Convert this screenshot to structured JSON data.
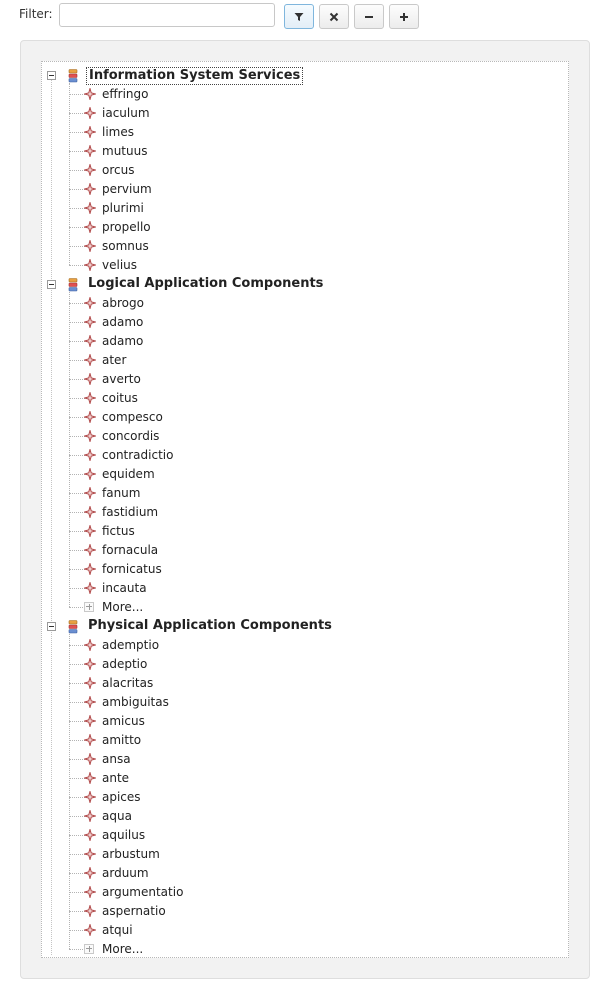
{
  "toolbar": {
    "filter_label": "Filter:",
    "filter_value": "",
    "buttons": [
      {
        "name": "filter-button",
        "icon": "funnel-icon"
      },
      {
        "name": "clear-filter-button",
        "icon": "close-icon"
      },
      {
        "name": "collapse-all-button",
        "icon": "minus-icon"
      },
      {
        "name": "expand-all-button",
        "icon": "plus-icon"
      }
    ]
  },
  "colors": {
    "leaf_icon": "#b04848",
    "group_icon_top": "#e8a040",
    "group_icon_mid": "#e05050",
    "group_icon_bottom": "#6a8ed0",
    "active_button_border": "#7fb6dd"
  },
  "tree": {
    "groups": [
      {
        "label": "Information System Services",
        "selected": true,
        "items": [
          "effringo",
          "iaculum",
          "limes",
          "mutuus",
          "orcus",
          "pervium",
          "plurimi",
          "propello",
          "somnus",
          "velius"
        ],
        "more": ""
      },
      {
        "label": "Logical Application Components",
        "selected": false,
        "items": [
          "abrogo",
          "adamo",
          "adamo",
          "ater",
          "averto",
          "coitus",
          "compesco",
          "concordis",
          "contradictio",
          "equidem",
          "fanum",
          "fastidium",
          "fictus",
          "fornacula",
          "fornicatus",
          "incauta"
        ],
        "more": "More..."
      },
      {
        "label": "Physical Application Components",
        "selected": false,
        "items": [
          "ademptio",
          "adeptio",
          "alacritas",
          "ambiguitas",
          "amicus",
          "amitto",
          "ansa",
          "ante",
          "apices",
          "aqua",
          "aquilus",
          "arbustum",
          "arduum",
          "argumentatio",
          "aspernatio",
          "atqui"
        ],
        "more": "More..."
      }
    ]
  }
}
